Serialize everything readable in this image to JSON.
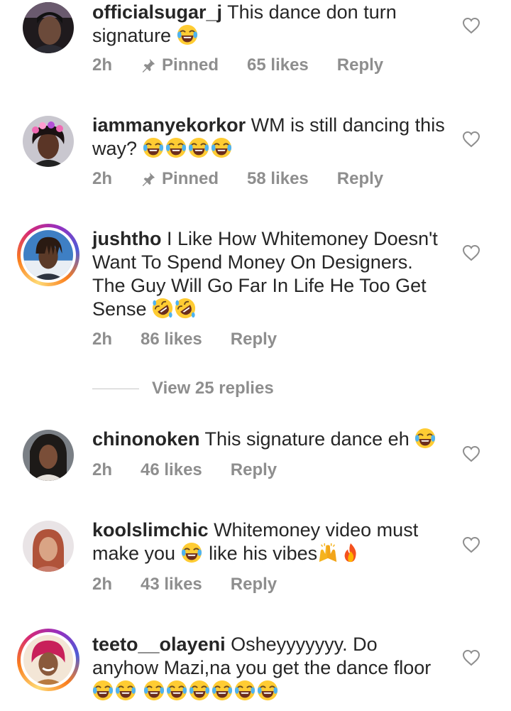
{
  "comments": [
    {
      "username": "officialsugar_j",
      "text": "This dance don turn signature",
      "emojis": [
        "joy"
      ],
      "time": "2h",
      "pinned_label": "Pinned",
      "likes": "65 likes",
      "reply_label": "Reply"
    },
    {
      "username": "iammanyekorkor",
      "text": "WM is still dancing this way?",
      "emojis": [
        "joy",
        "joy",
        "joy",
        "joy"
      ],
      "time": "2h",
      "pinned_label": "Pinned",
      "likes": "58 likes",
      "reply_label": "Reply"
    },
    {
      "username": "jushtho",
      "text": "I Like How Whitemoney Doesn't Want To Spend Money On Designers. The Guy Will Go Far In Life He Too Get Sense",
      "emojis": [
        "rofl",
        "rofl"
      ],
      "time": "2h",
      "likes": "86 likes",
      "reply_label": "Reply",
      "view_replies": "View 25 replies"
    },
    {
      "username": "chinonoken",
      "text": "This signature dance eh",
      "emojis": [
        "joy"
      ],
      "time": "2h",
      "likes": "46 likes",
      "reply_label": "Reply"
    },
    {
      "username": "koolslimchic",
      "text_a": "Whitemoney video must make you",
      "text_b": "like his vibes",
      "emojis": [
        "joy",
        "raising-hands",
        "fire"
      ],
      "time": "2h",
      "likes": "43 likes",
      "reply_label": "Reply"
    },
    {
      "username": "teeto__olayeni",
      "text": "Osheyyyyyyy. Do anyhow Mazi,na you get the dance floor",
      "emojis": [
        "joy",
        "joy",
        "joy",
        "joy",
        "joy",
        "joy",
        "joy",
        "joy"
      ]
    }
  ],
  "icons": {
    "like": "heart-outline-icon",
    "pinned": "pin-icon"
  },
  "colors": {
    "text": "#262626",
    "meta": "#8e8e8e",
    "divider": "#c7c7c7"
  }
}
